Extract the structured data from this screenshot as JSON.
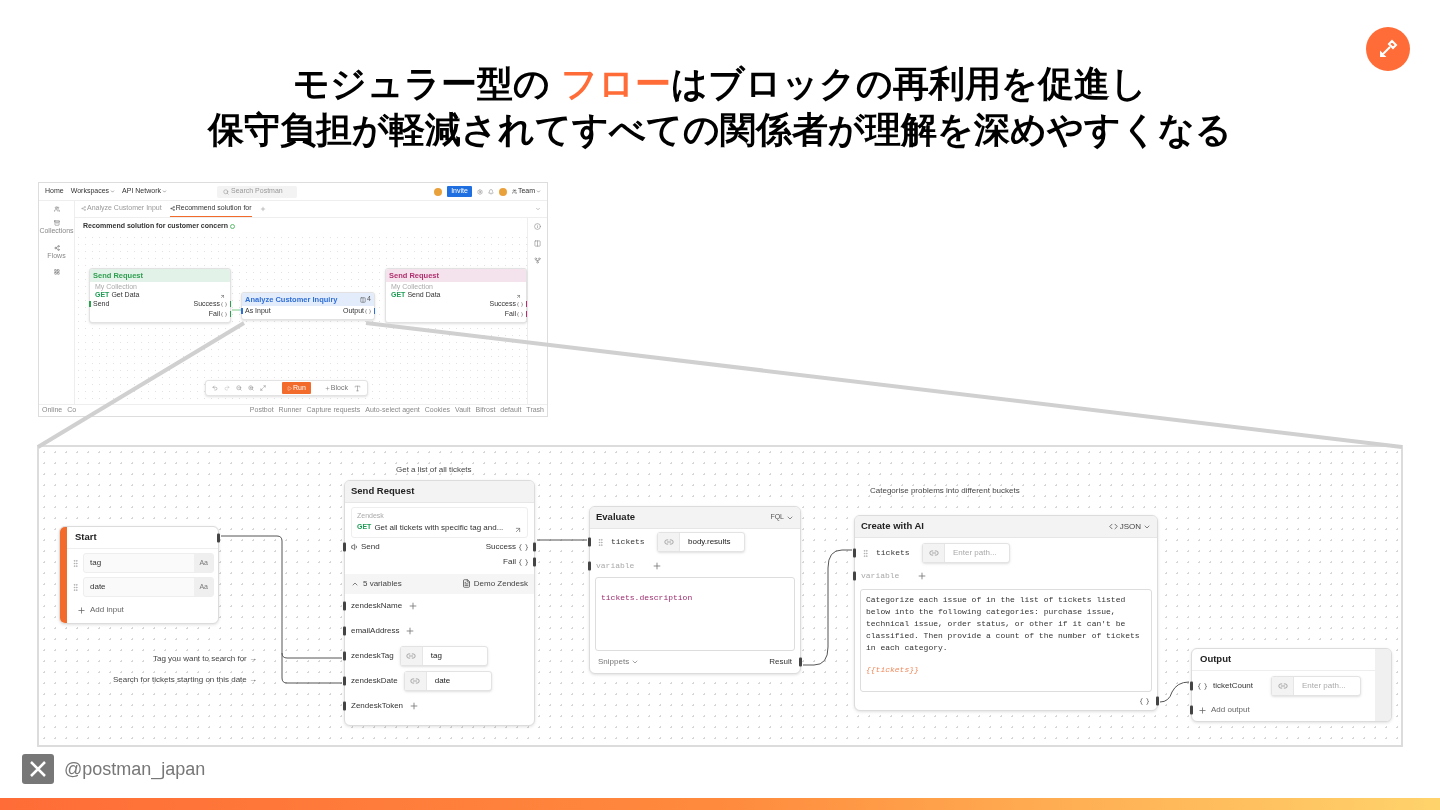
{
  "slide": {
    "title_lines": [
      [
        {
          "text": "モジュラー型の ",
          "accent": false
        },
        {
          "text": "フロー",
          "accent": true
        },
        {
          "text": "はブロックの再利用を促進し",
          "accent": false
        }
      ],
      [
        {
          "text": "保守負担が軽減されてすべての関係者が理解を深めやすくなる",
          "accent": false
        }
      ]
    ],
    "footer_handle": "@postman_japan"
  },
  "app": {
    "nav": [
      {
        "label": "Home",
        "menu": false
      },
      {
        "label": "Workspaces",
        "menu": true
      },
      {
        "label": "API Network",
        "menu": true
      }
    ],
    "search_placeholder": "Search Postman",
    "invite": "Invite",
    "team": "Team",
    "sidebar": [
      {
        "kind": "team"
      },
      {
        "kind": "collections",
        "label": "Collections"
      },
      {
        "kind": "flows",
        "label": "Flows"
      },
      {
        "kind": "apps"
      }
    ],
    "tabs": [
      {
        "label": "Analyze Customer Input",
        "selected": false
      },
      {
        "label": "Recommend solution for",
        "selected": true
      }
    ],
    "flow_title": "Recommend solution for customer concern",
    "nodes": [
      {
        "title": "Send Request",
        "color": "#2e9e4f",
        "collection": "My Collection",
        "method": "GET",
        "request": "Get Data",
        "inputs": [
          "Send"
        ],
        "outputs": [
          "Success",
          "Fail"
        ]
      },
      {
        "title": "Analyze Customer Inquiry",
        "color": "#2f6fd6",
        "count": "4",
        "inputs": [
          "As Input"
        ],
        "outputs": [
          "Output"
        ]
      },
      {
        "title": "Send Request",
        "color": "#b0306f",
        "collection": "My Collection",
        "method": "GET",
        "request": "Send Data",
        "outputs": [
          "Success",
          "Fail"
        ]
      }
    ],
    "toolbar": {
      "run": "Run",
      "block": "Block"
    },
    "status_left": [
      "Online",
      "Co"
    ],
    "status_right": [
      "Postbot",
      "Runner",
      "Capture requests",
      "Auto-select agent",
      "Cookies",
      "Vault",
      "Bifrost",
      "default",
      "Trash"
    ]
  },
  "flow": {
    "notes": [
      "Get a list of all tickets",
      "Categorise problems into different buckets",
      "Tag you want to search for →",
      "Search for tickets starting on this date →"
    ],
    "nodes": [
      {
        "kind": "start",
        "title": "Start",
        "inputs": [
          {
            "name": "tag",
            "type": "Aa"
          },
          {
            "name": "date",
            "type": "Aa"
          }
        ],
        "add_label": "Add input"
      },
      {
        "kind": "request",
        "title": "Send Request",
        "collection": "Zendesk",
        "method": "GET",
        "request": "Get all tickets with specific tag and...",
        "trigger": "Send",
        "outputs": [
          "Success",
          "Fail"
        ],
        "variables_label": "5 variables",
        "variables_expanded": true,
        "environment": "Demo Zendesk",
        "variables": [
          {
            "name": "zendeskName"
          },
          {
            "name": "emailAddress"
          },
          {
            "name": "zendeskTag",
            "value": "tag"
          },
          {
            "name": "zendeskDate",
            "value": "date"
          },
          {
            "name": "ZendeskToken"
          }
        ]
      },
      {
        "kind": "evaluate",
        "title": "Evaluate",
        "language": "FQL",
        "inputs": [
          {
            "name": "tickets",
            "value": "body.results"
          }
        ],
        "variable_placeholder": "variable",
        "code": "tickets.description",
        "snippets": "Snippets",
        "output": "Result"
      },
      {
        "kind": "ai",
        "title": "Create with AI",
        "format": "JSON",
        "inputs": [
          {
            "name": "tickets",
            "placeholder": "Enter path..."
          }
        ],
        "variable_placeholder": "variable",
        "prompt": "Categorize each issue of in the list of tickets listed\nbelow into the following categories: purchase issue,\ntechnical issue, order status, or other if it can't be\nclassified. Then provide a count of the number of tickets\nin each category.",
        "template": "{{tickets}}"
      },
      {
        "kind": "output",
        "title": "Output",
        "outputs": [
          {
            "name": "ticketCount",
            "placeholder": "Enter path..."
          }
        ],
        "add_label": "Add output"
      }
    ]
  }
}
